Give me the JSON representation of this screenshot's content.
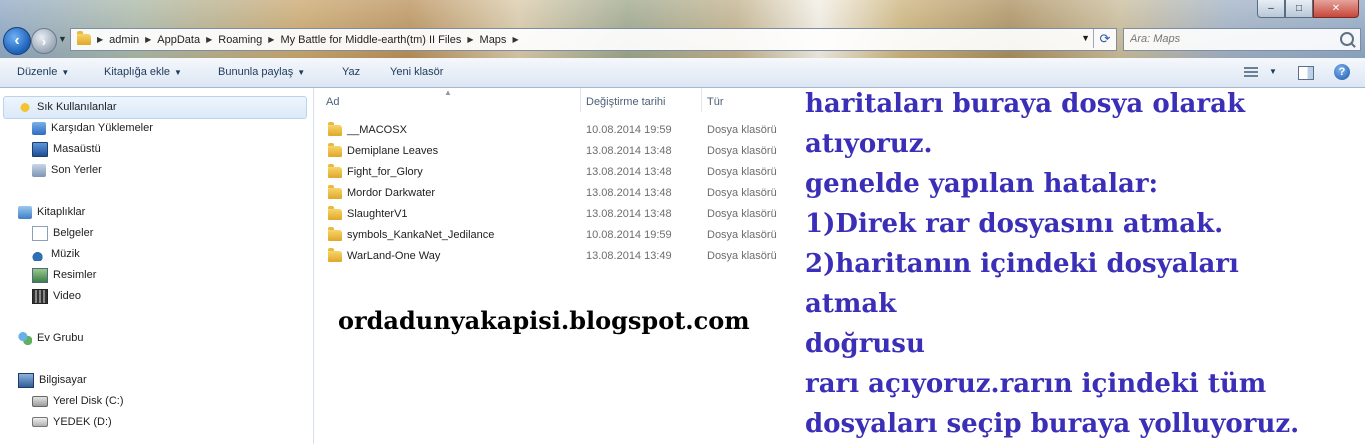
{
  "window": {
    "controls": {
      "minimize": "–",
      "maximize": "□",
      "close": "✕"
    }
  },
  "address_bar": {
    "breadcrumbs": [
      "admin",
      "AppData",
      "Roaming",
      "My Battle for Middle-earth(tm) II Files",
      "Maps"
    ]
  },
  "search": {
    "placeholder": "Ara: Maps"
  },
  "toolbar": {
    "items": [
      "Düzenle",
      "Kitaplığa ekle",
      "Bununla paylaş",
      "Yaz",
      "Yeni klasör"
    ],
    "help_label": "?"
  },
  "nav_pane": {
    "favorites": {
      "label": "Sık Kullanılanlar",
      "items": [
        "Karşıdan Yüklemeler",
        "Masaüstü",
        "Son Yerler"
      ]
    },
    "libraries": {
      "label": "Kitaplıklar",
      "items": [
        "Belgeler",
        "Müzik",
        "Resimler",
        "Video"
      ]
    },
    "homegroup": {
      "label": "Ev Grubu"
    },
    "computer": {
      "label": "Bilgisayar",
      "items": [
        "Yerel Disk (C:)",
        "YEDEK (D:)"
      ]
    }
  },
  "file_list": {
    "columns": [
      "Ad",
      "Değiştirme tarihi",
      "Tür"
    ],
    "rows": [
      {
        "name": "__MACOSX",
        "date": "10.08.2014 19:59",
        "type": "Dosya klasörü"
      },
      {
        "name": "Demiplane Leaves",
        "date": "13.08.2014 13:48",
        "type": "Dosya klasörü"
      },
      {
        "name": "Fight_for_Glory",
        "date": "13.08.2014 13:48",
        "type": "Dosya klasörü"
      },
      {
        "name": "Mordor Darkwater",
        "date": "13.08.2014 13:48",
        "type": "Dosya klasörü"
      },
      {
        "name": "SlaughterV1",
        "date": "13.08.2014 13:48",
        "type": "Dosya klasörü"
      },
      {
        "name": "symbols_KankaNet_Jedilance",
        "date": "10.08.2014 19:59",
        "type": "Dosya klasörü"
      },
      {
        "name": "WarLand-One Way",
        "date": "13.08.2014 13:49",
        "type": "Dosya klasörü"
      }
    ]
  },
  "overlay": {
    "url": "ordadunyakapisi.blogspot.com",
    "note_lines": [
      "haritaları buraya dosya olarak",
      "atıyoruz.",
      "genelde yapılan hatalar:",
      "1)Direk rar dosyasını atmak.",
      "2)haritanın içindeki dosyaları",
      "atmak",
      "doğrusu",
      "rarı açıyoruz.rarın içindeki tüm",
      "dosyaları seçip buraya yolluyoruz."
    ],
    "note_color": "#3b2fb8"
  }
}
